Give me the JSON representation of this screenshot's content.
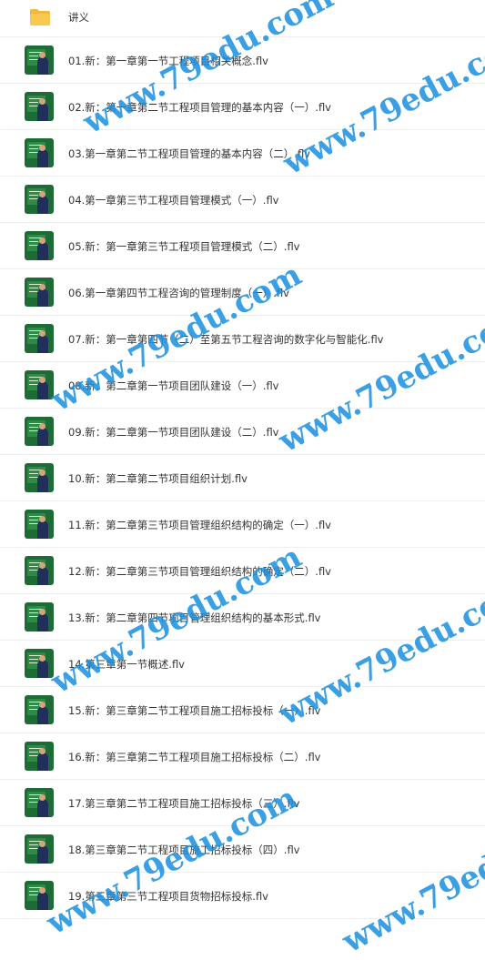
{
  "folder": {
    "label": "讲义"
  },
  "files": [
    "01.新：第一章第一节工程项目相关概念.flv",
    "02.新：第一章第二节工程项目管理的基本内容（一）.flv",
    "03.第一章第二节工程项目管理的基本内容（二）.flv",
    "04.第一章第三节工程项目管理模式（一）.flv",
    "05.新：第一章第三节工程项目管理模式（二）.flv",
    "06.第一章第四节工程咨询的管理制度（一）.flv",
    "07.新：第一章第四节（二）至第五节工程咨询的数字化与智能化.flv",
    "08.新：第二章第一节项目团队建设（一）.flv",
    "09.新：第二章第一节项目团队建设（二）.flv",
    "10.新：第二章第二节项目组织计划.flv",
    "11.新：第二章第三节项目管理组织结构的确定（一）.flv",
    "12.新：第二章第三节项目管理组织结构的确定（二）.flv",
    "13.新：第二章第四节项目管理组织结构的基本形式.flv",
    "14.第三章第一节概述.flv",
    "15.新：第三章第二节工程项目施工招标投标（一）.flv",
    "16.新：第三章第二节工程项目施工招标投标（二）.flv",
    "17.第三章第二节工程项目施工招标投标（三）.flv",
    "18.第三章第二节工程项目施工招标投标（四）.flv",
    "19.第三章第三节工程项目货物招标投标.flv"
  ],
  "watermark": "www.79edu.com",
  "colors": {
    "watermark": "#1a8fe0",
    "folder": "#f5b73b",
    "thumb_bg": "#1d6b35"
  }
}
